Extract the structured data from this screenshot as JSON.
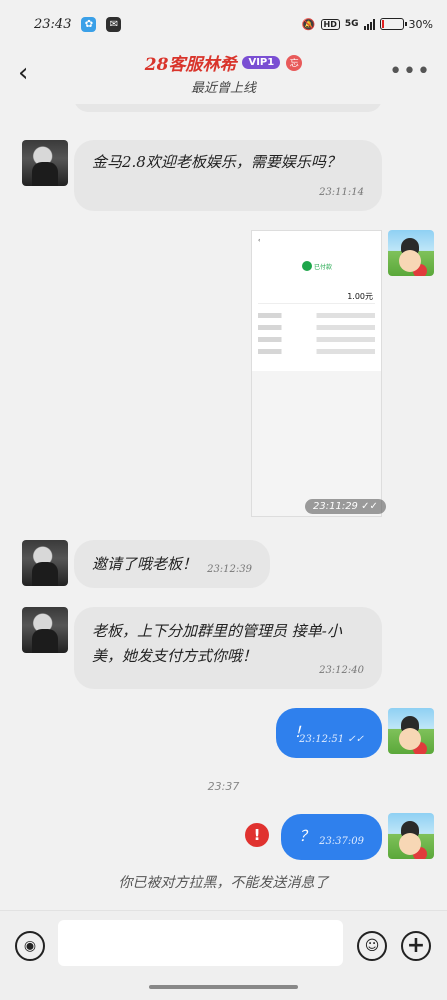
{
  "status_bar": {
    "time": "23:43",
    "hd": "HD",
    "network": "5G",
    "battery": "30%"
  },
  "header": {
    "back_glyph": "‹",
    "title": "28客服林希",
    "vip_label": "VIP1",
    "badge": "忘",
    "subtitle": "最近曾上线",
    "more_glyph": "•••"
  },
  "messages": [
    {
      "from": "other",
      "text": "金马2.8欢迎老板娱乐，需要娱乐吗？",
      "time": "23:11:14"
    },
    {
      "from": "me",
      "type": "image",
      "time": "23:11:29",
      "receipt": {
        "status_text": "已付款",
        "amount": "1.00元"
      }
    },
    {
      "from": "other",
      "text": "邀请了哦老板！",
      "time": "23:12:39"
    },
    {
      "from": "other",
      "text": "老板，上下分加群里的管理员 接单-小美，她发支付方式你哦！",
      "time": "23:12:40"
    },
    {
      "from": "me",
      "text": "！",
      "time": "23:12:51"
    },
    {
      "from": "me",
      "text": "？",
      "time": "23:37:09",
      "failed": true
    }
  ],
  "center_time": "23:37",
  "blocked_note": "你已被对方拉黑，不能发送消息了",
  "input": {
    "value": "",
    "placeholder": ""
  },
  "icons": {
    "voice": "voice-icon",
    "emoji": "emoji-icon",
    "plus": "plus-icon",
    "error": "error-icon"
  },
  "colors": {
    "title": "#d9342b",
    "vip": "#7a4fd3",
    "my_bubble": "#2f80ed",
    "other_bubble": "#e6e6e6",
    "error": "#e0322f"
  }
}
